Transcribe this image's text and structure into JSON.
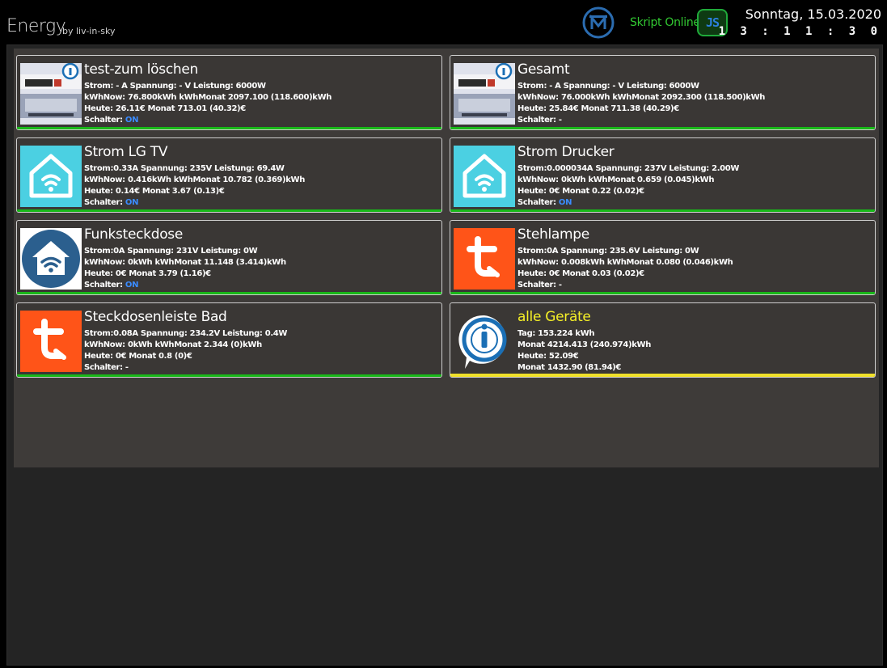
{
  "header": {
    "title": "Energy",
    "byline": "by liv-in-sky",
    "script_status": "Skript Online",
    "js_label": "JS",
    "date": "Sonntag, 15.03.2020",
    "time": "1 3 : 1 1 : 3 0"
  },
  "colors": {
    "status_green": "#19b819",
    "total_yellow": "#f5ef27",
    "switch_on_blue": "#3b8cff"
  },
  "devices": [
    {
      "name": "test-zum löschen",
      "icon": "energy-meter-icon",
      "line1": "Strom: - A Spannung: - V Leistung: 6000W",
      "line2": "kWhNow: 76.800kWh kWhMonat 2097.100 (118.600)kWh",
      "line3": "Heute: 26.11€ Monat 713.01 (40.32)€",
      "switch_label": "Schalter:",
      "switch_value": "ON"
    },
    {
      "name": "Gesamt",
      "icon": "energy-meter-icon",
      "line1": "Strom: - A Spannung: - V Leistung: 6000W",
      "line2": "kWhNow: 76.000kWh kWhMonat 2092.300 (118.500)kWh",
      "line3": "Heute: 25.84€ Monat 711.38 (40.29)€",
      "switch_label": "Schalter:",
      "switch_value": "-"
    },
    {
      "name": "Strom LG TV",
      "icon": "smart-home-icon",
      "line1": "Strom:0.33A Spannung: 235V Leistung: 69.4W",
      "line2": "kWhNow: 0.416kWh kWhMonat 10.782 (0.369)kWh",
      "line3": "Heute: 0.14€ Monat 3.67 (0.13)€",
      "switch_label": "Schalter:",
      "switch_value": "ON"
    },
    {
      "name": "Strom Drucker",
      "icon": "smart-home-icon",
      "line1": "Strom:0.000034A Spannung: 237V Leistung: 2.00W",
      "line2": "kWhNow: 0kWh kWhMonat 0.659 (0.045)kWh",
      "line3": "Heute: 0€ Monat 0.22 (0.02)€",
      "switch_label": "Schalter:",
      "switch_value": "ON"
    },
    {
      "name": "Funksteckdose",
      "icon": "home-wifi-icon",
      "line1": "Strom:0A Spannung: 231V Leistung: 0W",
      "line2": "kWhNow: 0kWh kWhMonat 11.148 (3.414)kWh",
      "line3": "Heute: 0€ Monat 3.79 (1.16)€",
      "switch_label": "Schalter:",
      "switch_value": "ON"
    },
    {
      "name": "Stehlampe",
      "icon": "tuya-icon",
      "line1": "Strom:0A Spannung: 235.6V Leistung: 0W",
      "line2": "kWhNow: 0.008kWh kWhMonat 0.080 (0.046)kWh",
      "line3": "Heute: 0€ Monat 0.03 (0.02)€",
      "switch_label": "Schalter:",
      "switch_value": "-"
    },
    {
      "name": "Steckdosenleiste Bad",
      "icon": "tuya-icon",
      "line1": "Strom:0.08A Spannung: 234.2V Leistung: 0.4W",
      "line2": "kWhNow: 0kWh kWhMonat 2.344 (0)kWh",
      "line3": "Heute: 0€ Monat 0.8 (0)€",
      "switch_label": "Schalter:",
      "switch_value": "-"
    }
  ],
  "total": {
    "name": "alle Geräte",
    "icon": "iobroker-icon",
    "line1": "Tag: 153.224 kWh",
    "line2": "Monat 4214.413 (240.974)kWh",
    "line3": "Heute: 52.09€",
    "line4": "Monat 1432.90 (81.94)€"
  }
}
